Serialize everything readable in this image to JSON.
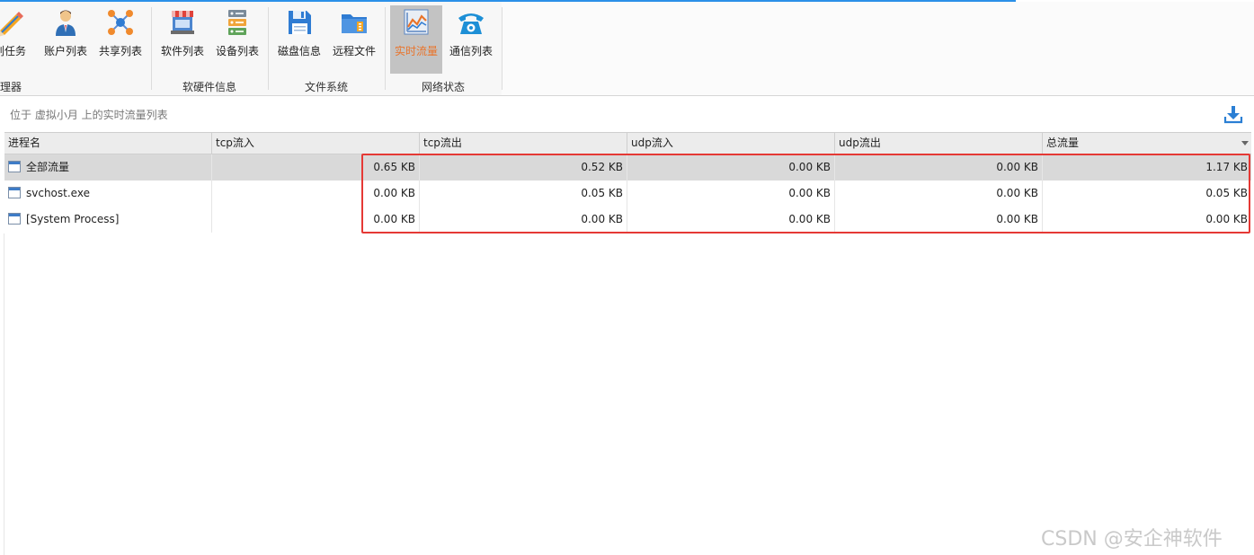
{
  "ribbon": {
    "buttons": [
      {
        "label": "划任务",
        "icon": "pencil-icon"
      },
      {
        "label": "账户列表",
        "icon": "user-account-icon"
      },
      {
        "label": "共享列表",
        "icon": "share-network-icon"
      },
      {
        "label": "软件列表",
        "icon": "software-store-icon"
      },
      {
        "label": "设备列表",
        "icon": "server-devices-icon"
      },
      {
        "label": "磁盘信息",
        "icon": "floppy-disk-icon"
      },
      {
        "label": "远程文件",
        "icon": "remote-file-folder-icon"
      },
      {
        "label": "实时流量",
        "icon": "line-chart-icon",
        "active": true
      },
      {
        "label": "通信列表",
        "icon": "telephone-icon"
      }
    ],
    "groups": [
      "理器",
      "软硬件信息",
      "文件系统",
      "网络状态"
    ]
  },
  "infobar": {
    "text": "位于 虚拟小月 上的实时流量列表",
    "download_icon": "download-icon"
  },
  "table": {
    "columns": [
      "进程名",
      "tcp流入",
      "tcp流出",
      "udp流入",
      "udp流出",
      "总流量"
    ],
    "sorted_column": "总流量",
    "rows": [
      {
        "name": "全部流量",
        "tcp_in": "0.65 KB",
        "tcp_out": "0.52 KB",
        "udp_in": "0.00 KB",
        "udp_out": "0.00 KB",
        "total": "1.17 KB",
        "selected": true
      },
      {
        "name": "svchost.exe",
        "tcp_in": "0.00 KB",
        "tcp_out": "0.05 KB",
        "udp_in": "0.00 KB",
        "udp_out": "0.00 KB",
        "total": "0.05 KB"
      },
      {
        "name": "[System Process]",
        "tcp_in": "0.00 KB",
        "tcp_out": "0.00 KB",
        "udp_in": "0.00 KB",
        "udp_out": "0.00 KB",
        "total": "0.00 KB"
      }
    ]
  },
  "watermark": "CSDN @安企神软件",
  "colors": {
    "accent": "#2b90e8",
    "active_label": "#e9742b",
    "highlight_box": "#e53935",
    "selected_row": "#d9d9d9"
  }
}
